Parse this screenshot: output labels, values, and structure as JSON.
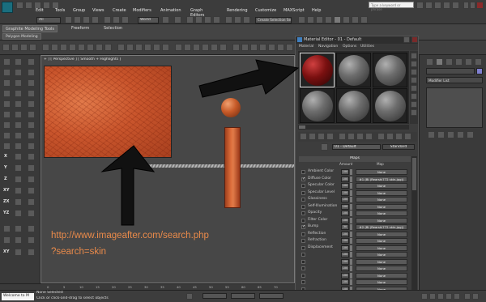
{
  "menu": {
    "items": [
      "Edit",
      "Tools",
      "Group",
      "Views",
      "Create",
      "Modifiers",
      "Animation",
      "Graph Editors",
      "Rendering",
      "Customize",
      "MAXScript",
      "Help"
    ],
    "selection_filter": "All",
    "view_dropdown": "World",
    "named_selection": "Create Selection Se",
    "search_placeholder": "Type a keyword or phrase"
  },
  "ribbon": {
    "tabs": [
      "Graphite Modeling Tools",
      "Freeform",
      "Selection"
    ],
    "subtab": "Polygon Modeling"
  },
  "viewport": {
    "label": "+ ] [ Perspective ] [ Smooth + Highlights ]",
    "caption_line1": "http://www.imageafter.com/search.php",
    "caption_line2": "?search=skin"
  },
  "left_axes": [
    "X",
    "Y",
    "Z",
    "XY",
    "ZX",
    "YZ",
    "XY"
  ],
  "material_editor": {
    "title": "Material Editor - 01 - Default",
    "menu": [
      "Material",
      "Navigation",
      "Options",
      "Utilities"
    ],
    "material_name": "01 - Default",
    "material_type": "Standard",
    "maps_header": "Maps",
    "col_amount": "Amount",
    "col_map": "Map",
    "maps": [
      {
        "label": "Ambient Color",
        "amount": "100",
        "map": "None",
        "checked": false
      },
      {
        "label": "Diffuse Color",
        "amount": "100",
        "map": "#1 (Bi (Rearshi772 skin.jpg))",
        "checked": true
      },
      {
        "label": "Specular Color",
        "amount": "100",
        "map": "None",
        "checked": false
      },
      {
        "label": "Specular Level",
        "amount": "100",
        "map": "None",
        "checked": false
      },
      {
        "label": "Glossiness",
        "amount": "100",
        "map": "None",
        "checked": false
      },
      {
        "label": "Self-Illumination",
        "amount": "100",
        "map": "None",
        "checked": false
      },
      {
        "label": "Opacity",
        "amount": "100",
        "map": "None",
        "checked": false
      },
      {
        "label": "Filter Color",
        "amount": "100",
        "map": "None",
        "checked": false
      },
      {
        "label": "Bump",
        "amount": "30",
        "map": "#2 (Bi (Rearshi772 skin.jpg))",
        "checked": true
      },
      {
        "label": "Reflection",
        "amount": "100",
        "map": "None",
        "checked": false
      },
      {
        "label": "Refraction",
        "amount": "100",
        "map": "None",
        "checked": false
      },
      {
        "label": "Displacement",
        "amount": "100",
        "map": "None",
        "checked": false
      },
      {
        "label": "",
        "amount": "100",
        "map": "None",
        "checked": false
      },
      {
        "label": "",
        "amount": "100",
        "map": "None",
        "checked": false
      },
      {
        "label": "",
        "amount": "100",
        "map": "None",
        "checked": false
      },
      {
        "label": "",
        "amount": "100",
        "map": "None",
        "checked": false
      },
      {
        "label": "",
        "amount": "100",
        "map": "None",
        "checked": false
      },
      {
        "label": "",
        "amount": "100",
        "map": "None",
        "checked": false
      },
      {
        "label": "",
        "amount": "100",
        "map": "None",
        "checked": false
      }
    ]
  },
  "command_panel": {
    "modifier_list": "Modifier List"
  },
  "timeline": {
    "ticks": [
      "0",
      "5",
      "10",
      "15",
      "20",
      "25",
      "30",
      "35",
      "40",
      "45",
      "50",
      "55",
      "60",
      "65",
      "70"
    ]
  },
  "status": {
    "welcome": "Welcome to M",
    "line1": "None Selected",
    "line2": "Click or click-and-drag to select objects"
  },
  "colors": {
    "arrow": "#111111",
    "caption": "#e98a4a"
  }
}
